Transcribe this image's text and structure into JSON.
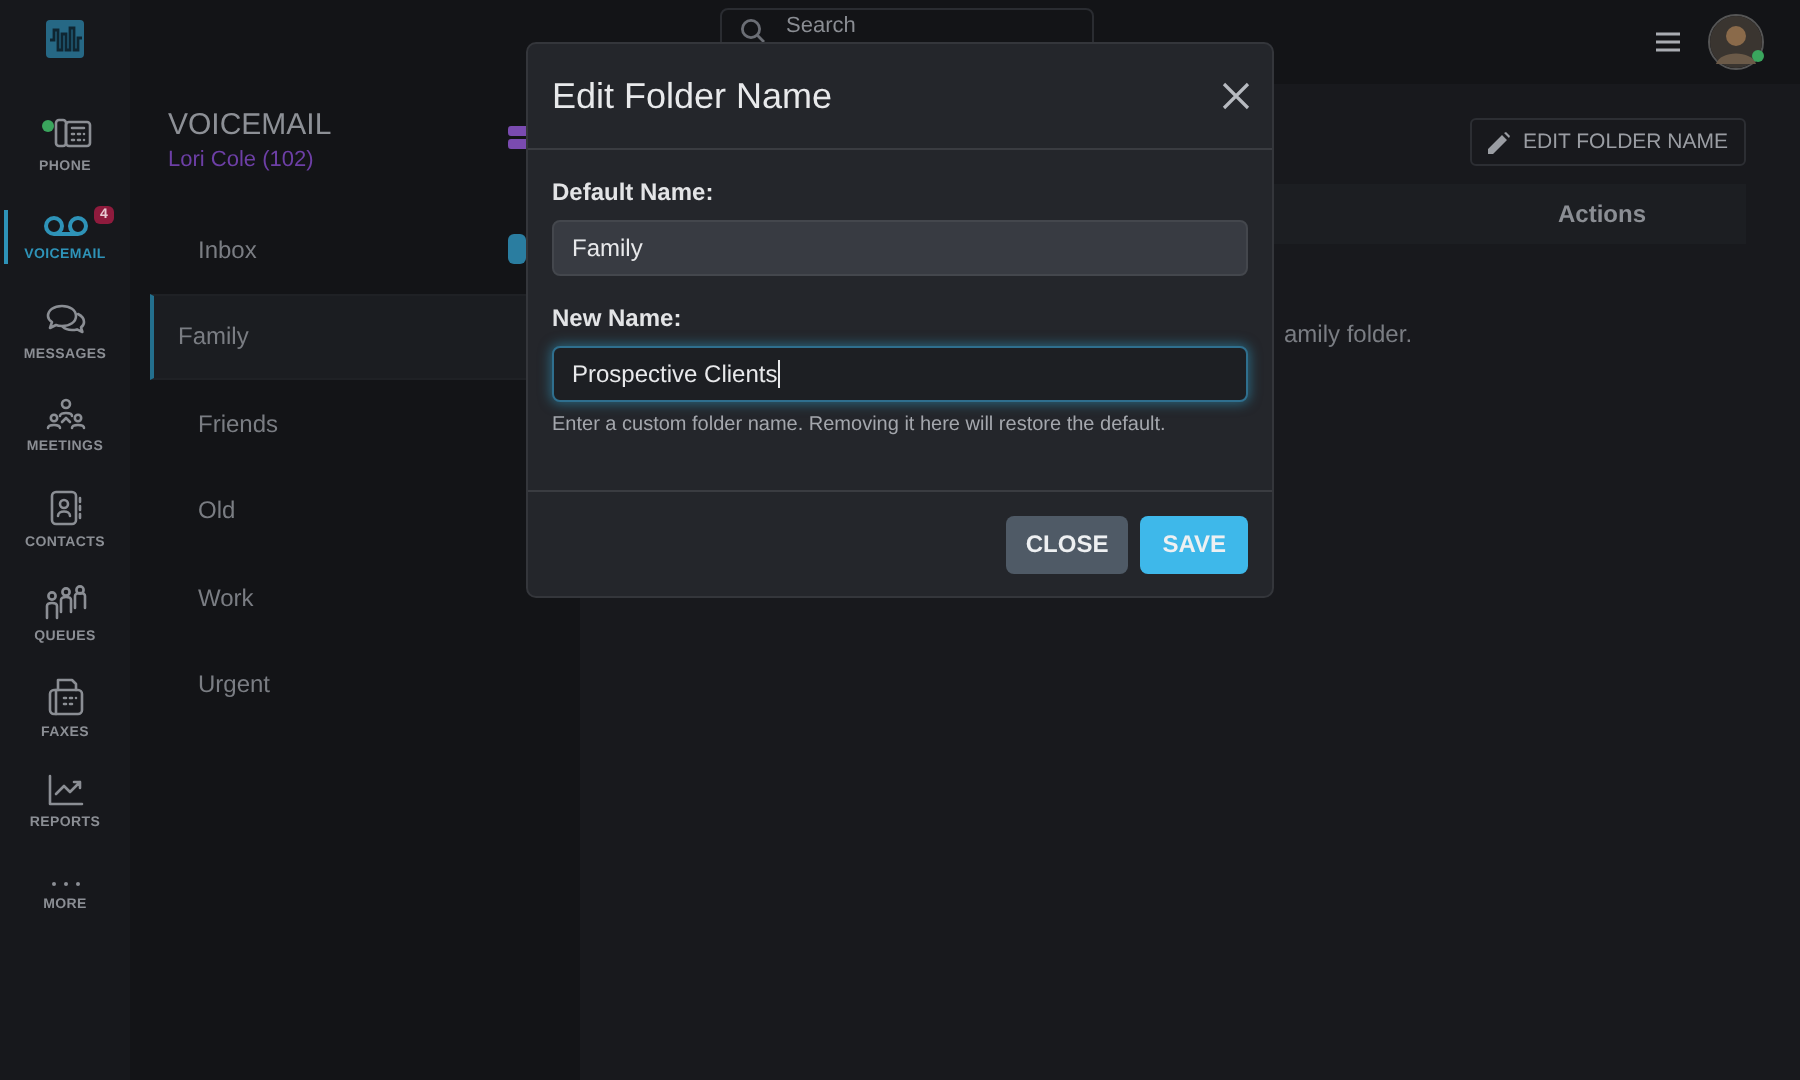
{
  "topbar": {
    "search": {
      "placeholder": "Search"
    }
  },
  "nav": [
    {
      "label": "PHONE",
      "selected": false
    },
    {
      "label": "VOICEMAIL",
      "selected": true,
      "badge": "4"
    },
    {
      "label": "MESSAGES",
      "selected": false
    },
    {
      "label": "MEETINGS",
      "selected": false
    },
    {
      "label": "CONTACTS",
      "selected": false
    },
    {
      "label": "QUEUES",
      "selected": false
    },
    {
      "label": "FAXES",
      "selected": false
    },
    {
      "label": "REPORTS",
      "selected": false
    },
    {
      "label": "MORE",
      "selected": false
    }
  ],
  "folders": {
    "title": "VOICEMAIL",
    "user": "Lori Cole (102)",
    "items": [
      {
        "label": "Inbox",
        "selected": false,
        "badge": true
      },
      {
        "label": "Family",
        "selected": true,
        "badge": false
      },
      {
        "label": "Friends",
        "selected": false,
        "badge": false
      },
      {
        "label": "Old",
        "selected": false,
        "badge": false
      },
      {
        "label": "Work",
        "selected": false,
        "badge": false
      },
      {
        "label": "Urgent",
        "selected": false,
        "badge": false
      }
    ]
  },
  "main": {
    "edit_button": "EDIT FOLDER NAME",
    "table": {
      "columns": [
        "Actions"
      ]
    },
    "empty_message": "amily folder."
  },
  "dialog": {
    "title": "Edit Folder Name",
    "fields": [
      {
        "label": "Default Name:",
        "value": "Family",
        "disabled": true,
        "focused": false
      },
      {
        "label": "New Name:",
        "value": "Prospective Clients",
        "disabled": false,
        "focused": true,
        "help": "Enter a custom folder name. Removing it here will restore the default."
      }
    ],
    "buttons": [
      {
        "label": "CLOSE",
        "kind": "secondary"
      },
      {
        "label": "SAVE",
        "kind": "primary"
      }
    ]
  }
}
